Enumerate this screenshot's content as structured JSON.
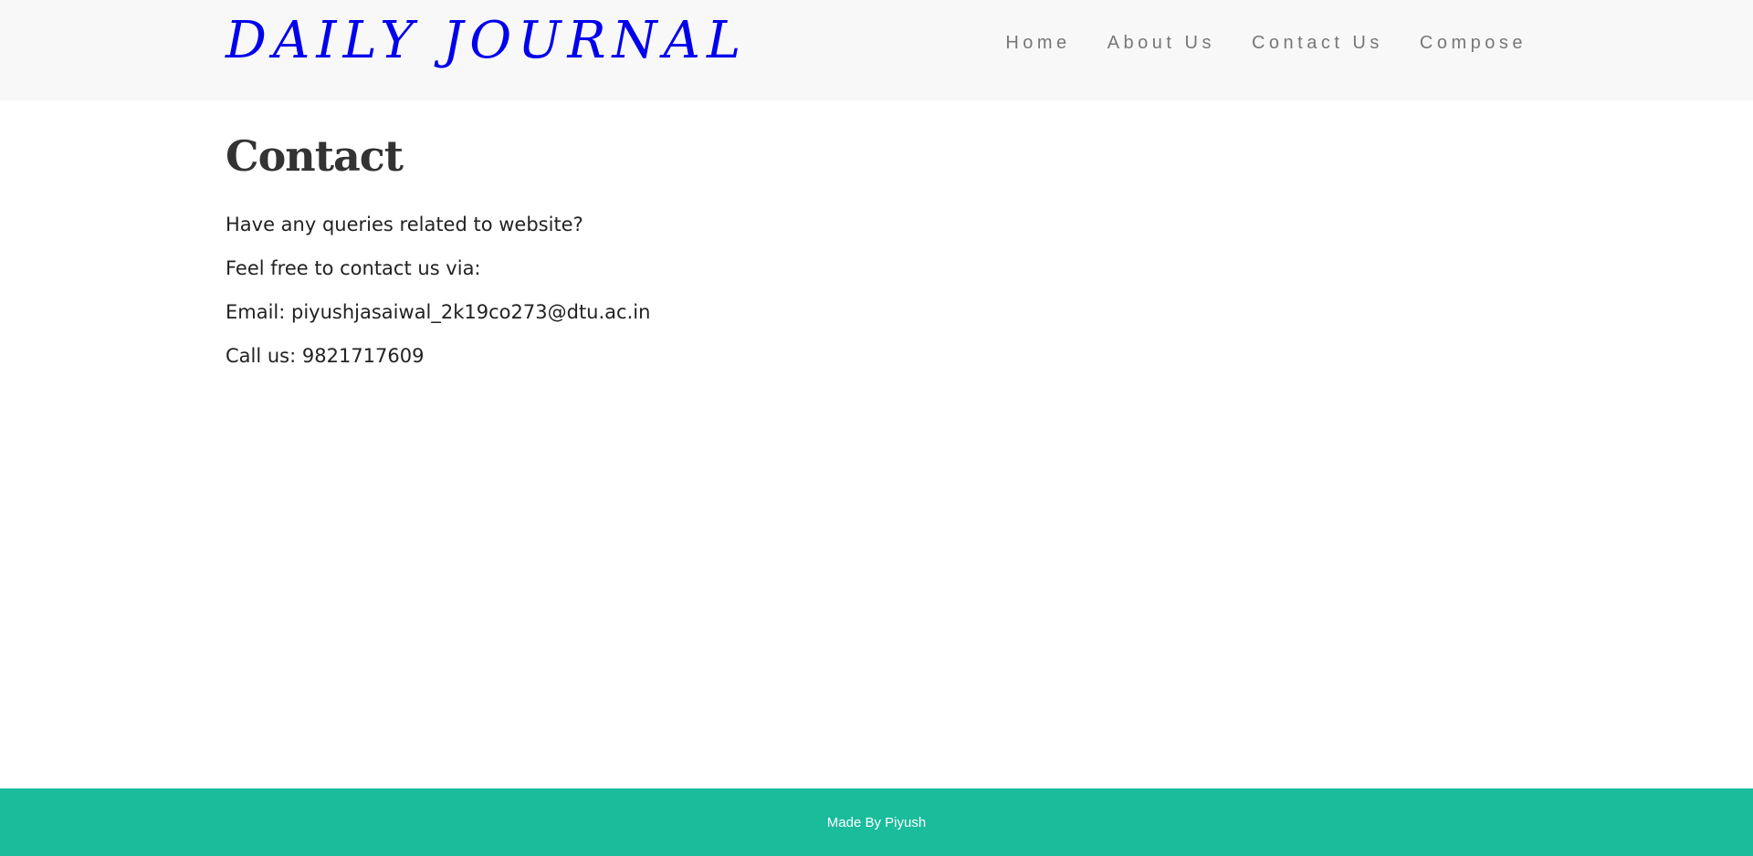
{
  "navbar": {
    "brand": "DAILY JOURNAL",
    "links": [
      {
        "label": "Home"
      },
      {
        "label": "About Us"
      },
      {
        "label": "Contact Us"
      },
      {
        "label": "Compose"
      }
    ]
  },
  "main": {
    "title": "Contact",
    "paragraphs": [
      "Have any queries related to website?",
      "Feel free to contact us via:",
      "Email: piyushjasaiwal_2k19co273@dtu.ac.in",
      "Call us: 9821717609"
    ]
  },
  "footer": {
    "text": "Made By Piyush"
  },
  "colors": {
    "brand": "#0000ee",
    "navbar_bg": "#f8f8f8",
    "footer_bg": "#1abc9c"
  }
}
